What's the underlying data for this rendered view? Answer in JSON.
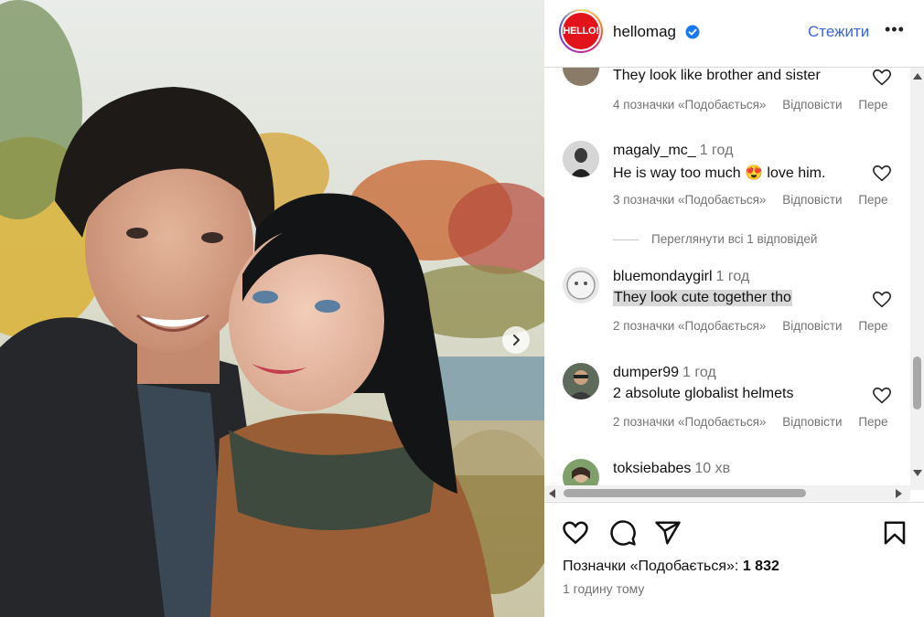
{
  "post": {
    "username": "hellomag",
    "avatar_logo": "HELLO!",
    "follow_label": "Стежити",
    "more_label": "•••",
    "likes_label": "Позначки «Подобається»:",
    "likes_count": "1 832",
    "time_ago": "1 годину тому"
  },
  "comments": [
    {
      "username": "",
      "time": "",
      "text": "They look like brother and sister",
      "likes": "4 позначки «Подобається»",
      "reply": "Відповісти",
      "translate": "Пере"
    },
    {
      "username": "magaly_mc_",
      "time": "1 год",
      "text": "He is way too much 😍 love him.",
      "likes": "3 позначки «Подобається»",
      "reply": "Відповісти",
      "translate": "Пере"
    },
    {
      "username": "bluemondaygirl",
      "time": "1 год",
      "text": "They look cute together tho",
      "likes": "2 позначки «Подобається»",
      "reply": "Відповісти",
      "translate": "Пере"
    },
    {
      "username": "dumper99",
      "time": "1 год",
      "text": "2 absolute globalist helmets",
      "likes": "2 позначки «Подобається»",
      "reply": "Відповісти",
      "translate": "Пере"
    },
    {
      "username": "toksiebabes",
      "time": "10 хв",
      "text": "",
      "likes": "",
      "reply": "",
      "translate": ""
    }
  ],
  "view_replies": "Переглянути всі 1 відповідей",
  "icons": {
    "verified": "verified-badge-icon",
    "like": "heart-icon",
    "comment": "comment-bubble-icon",
    "share": "paper-plane-icon",
    "save": "bookmark-icon",
    "next": "chevron-right-icon"
  },
  "colors": {
    "follow": "#3866d6",
    "verified": "#1877f2",
    "secondary_text": "#737373",
    "brand_red": "#e3131b"
  }
}
